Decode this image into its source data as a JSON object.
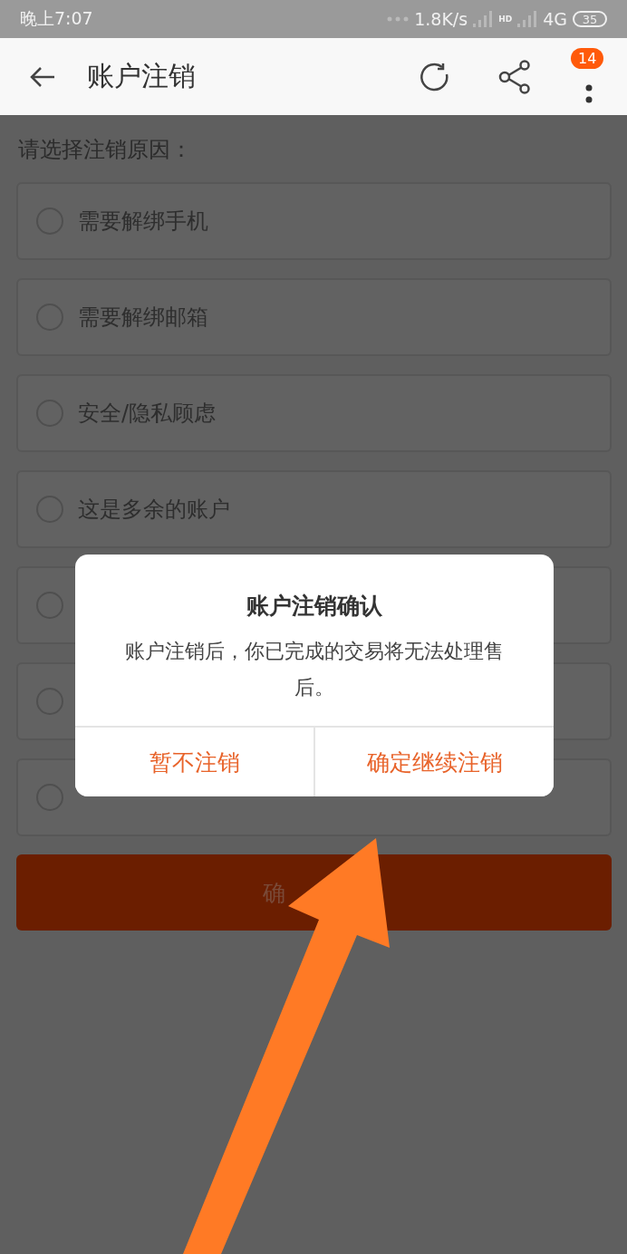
{
  "status_bar": {
    "time": "晚上7:07",
    "speed": "1.8K/s",
    "hd": "HD",
    "network": "4G",
    "battery": "35"
  },
  "header": {
    "title": "账户注销",
    "badge": "14"
  },
  "prompt": "请选择注销原因：",
  "options": [
    {
      "label": "需要解绑手机",
      "selected": false
    },
    {
      "label": "需要解绑邮箱",
      "selected": false
    },
    {
      "label": "安全/隐私顾虑",
      "selected": false
    },
    {
      "label": "这是多余的账户",
      "selected": false
    },
    {
      "selected": false
    },
    {
      "selected": false
    },
    {
      "selected": false
    }
  ],
  "confirm_button": "确",
  "dialog": {
    "title": "账户注销确认",
    "message": "账户注销后，你已完成的交易将无法处理售后。",
    "buttons": [
      "暂不注销",
      "确定继续注销"
    ]
  }
}
